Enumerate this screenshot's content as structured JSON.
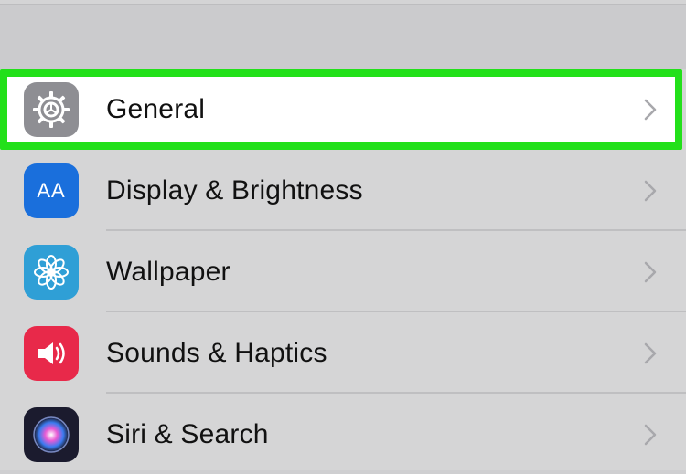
{
  "settings": {
    "items": [
      {
        "label": "General",
        "icon": "gear-icon",
        "icon_bg": "#8e8e93",
        "highlighted": true
      },
      {
        "label": "Display & Brightness",
        "icon": "text-size-icon",
        "icon_bg": "#1a6fdc",
        "icon_text": "AA",
        "highlighted": false
      },
      {
        "label": "Wallpaper",
        "icon": "flower-icon",
        "icon_bg": "#2f9fd6",
        "highlighted": false
      },
      {
        "label": "Sounds & Haptics",
        "icon": "speaker-icon",
        "icon_bg": "#e8294a",
        "highlighted": false
      },
      {
        "label": "Siri & Search",
        "icon": "siri-icon",
        "icon_bg": "#1b1b2e",
        "highlighted": false
      }
    ]
  },
  "colors": {
    "highlight_border": "#22e01a",
    "background": "#d4d4d5",
    "chevron": "#a8a8ac"
  }
}
